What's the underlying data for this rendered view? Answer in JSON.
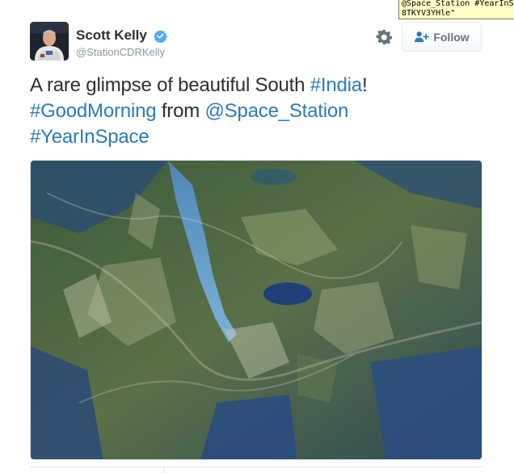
{
  "tooltip": {
    "line1": "@Space_Station #YearInSp",
    "line2": "8TKYV3YHle\""
  },
  "author": {
    "name": "Scott Kelly",
    "handle": "@StationCDRKelly",
    "verified_icon": "verified-badge-icon"
  },
  "actions": {
    "settings_icon": "gear-icon",
    "follow_label": "Follow",
    "follow_icon": "add-user-icon"
  },
  "tweet": {
    "t1": "A rare glimpse of beautiful South ",
    "hashtag_india": "#India",
    "t2": "!",
    "hashtag_goodmorning": "#GoodMorning",
    "t3": " from ",
    "mention_station": "@Space_Station",
    "hashtag_yearinspace": "#YearInSpace"
  },
  "colors": {
    "link": "#2b7bb9",
    "verified": "#55acee",
    "text": "#292f33",
    "muted": "#8899a6"
  }
}
